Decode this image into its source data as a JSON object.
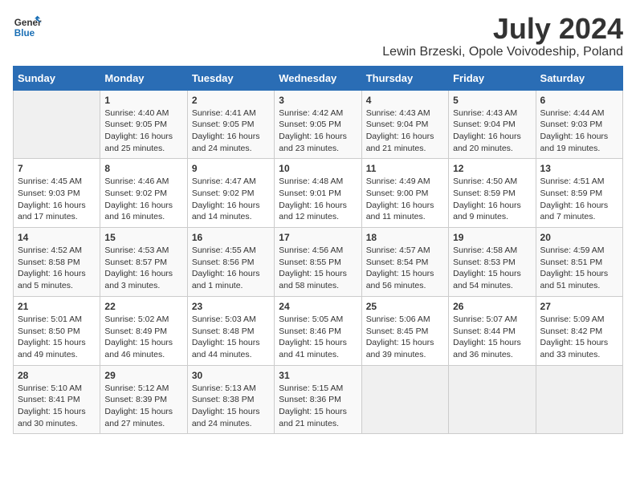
{
  "logo": {
    "text_general": "General",
    "text_blue": "Blue"
  },
  "title": "July 2024",
  "subtitle": "Lewin Brzeski, Opole Voivodeship, Poland",
  "columns": [
    "Sunday",
    "Monday",
    "Tuesday",
    "Wednesday",
    "Thursday",
    "Friday",
    "Saturday"
  ],
  "weeks": [
    [
      {
        "day": "",
        "info": ""
      },
      {
        "day": "1",
        "info": "Sunrise: 4:40 AM\nSunset: 9:05 PM\nDaylight: 16 hours\nand 25 minutes."
      },
      {
        "day": "2",
        "info": "Sunrise: 4:41 AM\nSunset: 9:05 PM\nDaylight: 16 hours\nand 24 minutes."
      },
      {
        "day": "3",
        "info": "Sunrise: 4:42 AM\nSunset: 9:05 PM\nDaylight: 16 hours\nand 23 minutes."
      },
      {
        "day": "4",
        "info": "Sunrise: 4:43 AM\nSunset: 9:04 PM\nDaylight: 16 hours\nand 21 minutes."
      },
      {
        "day": "5",
        "info": "Sunrise: 4:43 AM\nSunset: 9:04 PM\nDaylight: 16 hours\nand 20 minutes."
      },
      {
        "day": "6",
        "info": "Sunrise: 4:44 AM\nSunset: 9:03 PM\nDaylight: 16 hours\nand 19 minutes."
      }
    ],
    [
      {
        "day": "7",
        "info": "Sunrise: 4:45 AM\nSunset: 9:03 PM\nDaylight: 16 hours\nand 17 minutes."
      },
      {
        "day": "8",
        "info": "Sunrise: 4:46 AM\nSunset: 9:02 PM\nDaylight: 16 hours\nand 16 minutes."
      },
      {
        "day": "9",
        "info": "Sunrise: 4:47 AM\nSunset: 9:02 PM\nDaylight: 16 hours\nand 14 minutes."
      },
      {
        "day": "10",
        "info": "Sunrise: 4:48 AM\nSunset: 9:01 PM\nDaylight: 16 hours\nand 12 minutes."
      },
      {
        "day": "11",
        "info": "Sunrise: 4:49 AM\nSunset: 9:00 PM\nDaylight: 16 hours\nand 11 minutes."
      },
      {
        "day": "12",
        "info": "Sunrise: 4:50 AM\nSunset: 8:59 PM\nDaylight: 16 hours\nand 9 minutes."
      },
      {
        "day": "13",
        "info": "Sunrise: 4:51 AM\nSunset: 8:59 PM\nDaylight: 16 hours\nand 7 minutes."
      }
    ],
    [
      {
        "day": "14",
        "info": "Sunrise: 4:52 AM\nSunset: 8:58 PM\nDaylight: 16 hours\nand 5 minutes."
      },
      {
        "day": "15",
        "info": "Sunrise: 4:53 AM\nSunset: 8:57 PM\nDaylight: 16 hours\nand 3 minutes."
      },
      {
        "day": "16",
        "info": "Sunrise: 4:55 AM\nSunset: 8:56 PM\nDaylight: 16 hours\nand 1 minute."
      },
      {
        "day": "17",
        "info": "Sunrise: 4:56 AM\nSunset: 8:55 PM\nDaylight: 15 hours\nand 58 minutes."
      },
      {
        "day": "18",
        "info": "Sunrise: 4:57 AM\nSunset: 8:54 PM\nDaylight: 15 hours\nand 56 minutes."
      },
      {
        "day": "19",
        "info": "Sunrise: 4:58 AM\nSunset: 8:53 PM\nDaylight: 15 hours\nand 54 minutes."
      },
      {
        "day": "20",
        "info": "Sunrise: 4:59 AM\nSunset: 8:51 PM\nDaylight: 15 hours\nand 51 minutes."
      }
    ],
    [
      {
        "day": "21",
        "info": "Sunrise: 5:01 AM\nSunset: 8:50 PM\nDaylight: 15 hours\nand 49 minutes."
      },
      {
        "day": "22",
        "info": "Sunrise: 5:02 AM\nSunset: 8:49 PM\nDaylight: 15 hours\nand 46 minutes."
      },
      {
        "day": "23",
        "info": "Sunrise: 5:03 AM\nSunset: 8:48 PM\nDaylight: 15 hours\nand 44 minutes."
      },
      {
        "day": "24",
        "info": "Sunrise: 5:05 AM\nSunset: 8:46 PM\nDaylight: 15 hours\nand 41 minutes."
      },
      {
        "day": "25",
        "info": "Sunrise: 5:06 AM\nSunset: 8:45 PM\nDaylight: 15 hours\nand 39 minutes."
      },
      {
        "day": "26",
        "info": "Sunrise: 5:07 AM\nSunset: 8:44 PM\nDaylight: 15 hours\nand 36 minutes."
      },
      {
        "day": "27",
        "info": "Sunrise: 5:09 AM\nSunset: 8:42 PM\nDaylight: 15 hours\nand 33 minutes."
      }
    ],
    [
      {
        "day": "28",
        "info": "Sunrise: 5:10 AM\nSunset: 8:41 PM\nDaylight: 15 hours\nand 30 minutes."
      },
      {
        "day": "29",
        "info": "Sunrise: 5:12 AM\nSunset: 8:39 PM\nDaylight: 15 hours\nand 27 minutes."
      },
      {
        "day": "30",
        "info": "Sunrise: 5:13 AM\nSunset: 8:38 PM\nDaylight: 15 hours\nand 24 minutes."
      },
      {
        "day": "31",
        "info": "Sunrise: 5:15 AM\nSunset: 8:36 PM\nDaylight: 15 hours\nand 21 minutes."
      },
      {
        "day": "",
        "info": ""
      },
      {
        "day": "",
        "info": ""
      },
      {
        "day": "",
        "info": ""
      }
    ]
  ]
}
